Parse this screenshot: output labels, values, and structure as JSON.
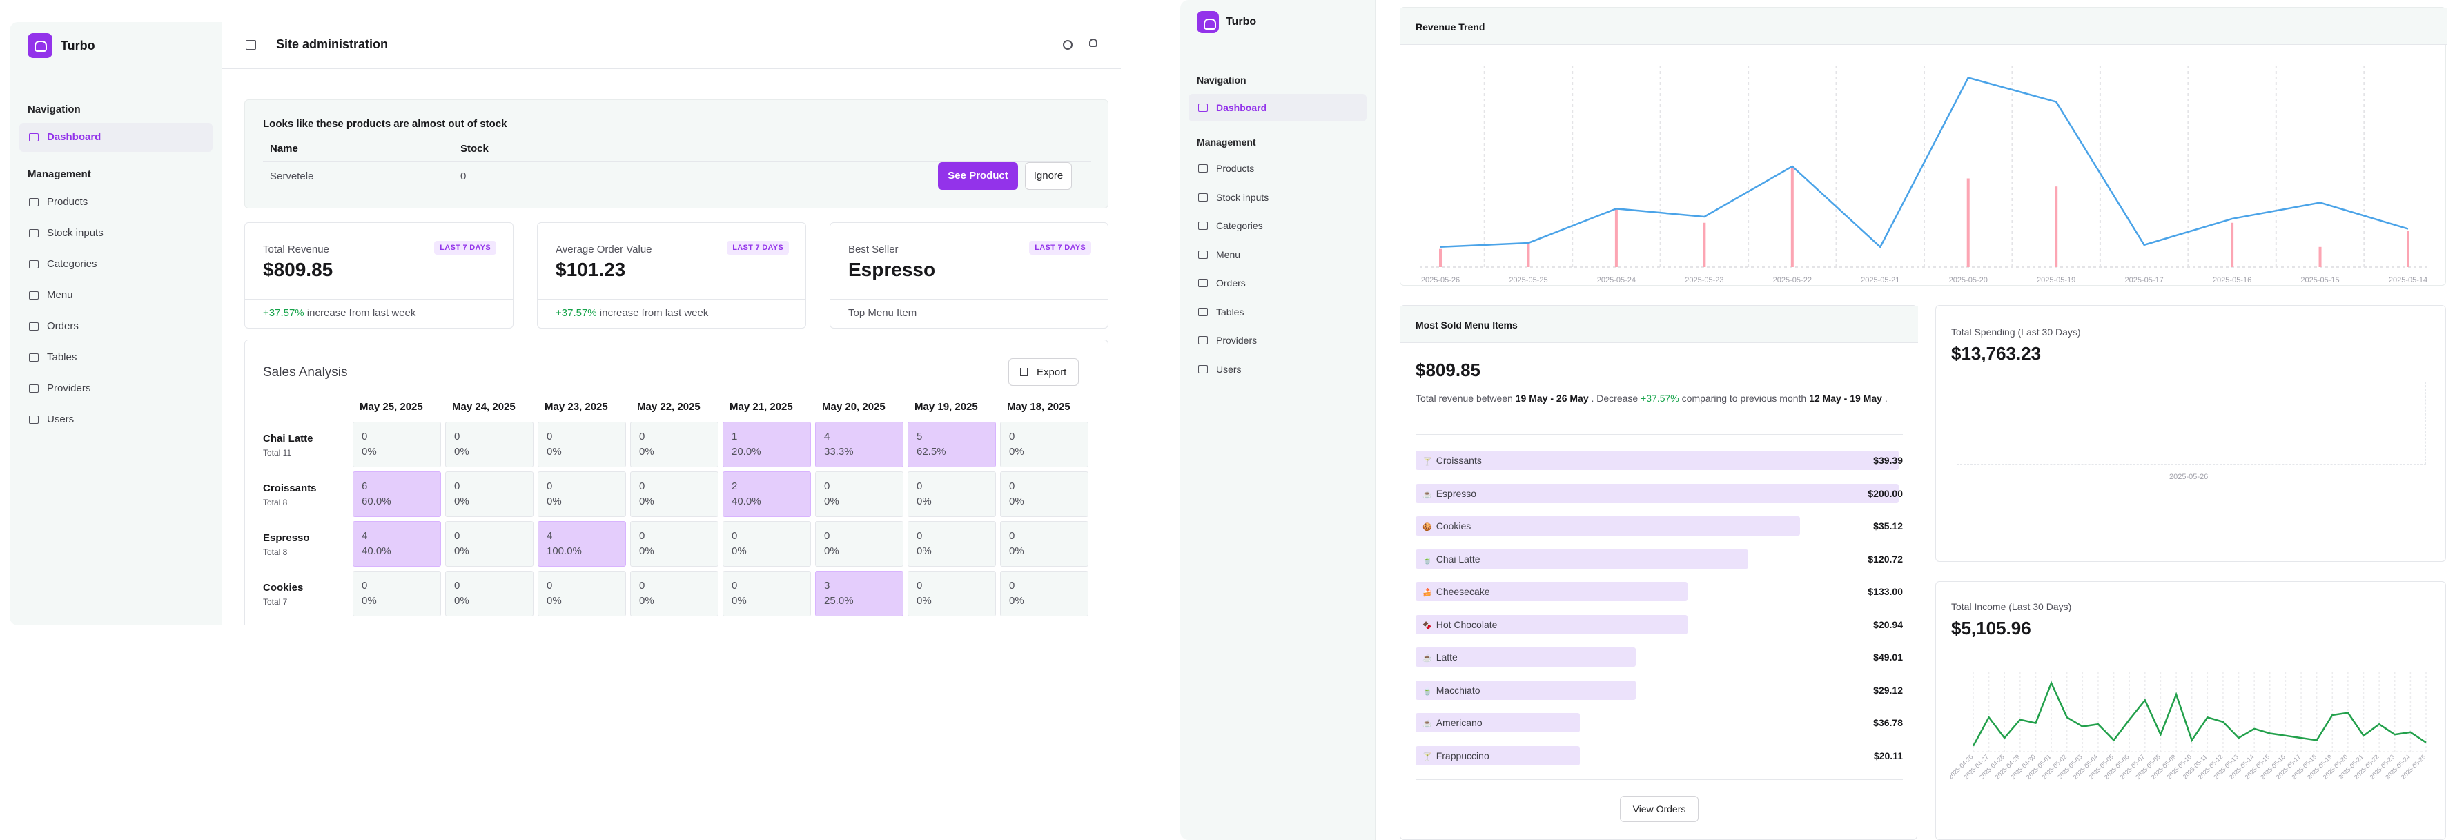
{
  "left": {
    "brand": "Turbo",
    "header_title": "Site administration",
    "nav_heading": "Navigation",
    "nav_active": "Dashboard",
    "mgmt_heading": "Management",
    "mgmt_items": [
      "Products",
      "Stock inputs",
      "Categories",
      "Menu",
      "Orders",
      "Tables",
      "Providers",
      "Users"
    ],
    "stock_alert": {
      "title": "Looks like these products are almost out of stock",
      "col_name": "Name",
      "col_stock": "Stock",
      "row_name": "Servetele",
      "row_stock": "0",
      "primary_btn": "See Product",
      "secondary_btn": "Ignore"
    },
    "stats": [
      {
        "label": "Total Revenue",
        "badge": "LAST 7 DAYS",
        "value": "$809.85",
        "delta": "+37.57%",
        "note": " increase from last week"
      },
      {
        "label": "Average Order Value",
        "badge": "LAST 7 DAYS",
        "value": "$101.23",
        "delta": "+37.57%",
        "note": " increase from last week"
      },
      {
        "label": "Best Seller",
        "badge": "LAST 7 DAYS",
        "value": "Espresso",
        "delta": "",
        "note": "Top Menu Item"
      }
    ],
    "sales": {
      "title": "Sales Analysis",
      "export": "Export",
      "dates": [
        "May 25, 2025",
        "May 24, 2025",
        "May 23, 2025",
        "May 22, 2025",
        "May 21, 2025",
        "May 20, 2025",
        "May 19, 2025",
        "May 18, 2025"
      ],
      "rows": [
        {
          "name": "Chai Latte",
          "total": "Total 11",
          "cells": [
            [
              "0",
              "0%"
            ],
            [
              "0",
              "0%"
            ],
            [
              "0",
              "0%"
            ],
            [
              "0",
              "0%"
            ],
            [
              "1",
              "20.0%"
            ],
            [
              "4",
              "33.3%"
            ],
            [
              "5",
              "62.5%"
            ],
            [
              "0",
              "0%"
            ]
          ]
        },
        {
          "name": "Croissants",
          "total": "Total 8",
          "cells": [
            [
              "6",
              "60.0%"
            ],
            [
              "0",
              "0%"
            ],
            [
              "0",
              "0%"
            ],
            [
              "0",
              "0%"
            ],
            [
              "2",
              "40.0%"
            ],
            [
              "0",
              "0%"
            ],
            [
              "0",
              "0%"
            ],
            [
              "0",
              "0%"
            ]
          ]
        },
        {
          "name": "Espresso",
          "total": "Total 8",
          "cells": [
            [
              "4",
              "40.0%"
            ],
            [
              "0",
              "0%"
            ],
            [
              "4",
              "100.0%"
            ],
            [
              "0",
              "0%"
            ],
            [
              "0",
              "0%"
            ],
            [
              "0",
              "0%"
            ],
            [
              "0",
              "0%"
            ],
            [
              "0",
              "0%"
            ]
          ]
        },
        {
          "name": "Cookies",
          "total": "Total 7",
          "cells": [
            [
              "0",
              "0%"
            ],
            [
              "0",
              "0%"
            ],
            [
              "0",
              "0%"
            ],
            [
              "0",
              "0%"
            ],
            [
              "0",
              "0%"
            ],
            [
              "3",
              "25.0%"
            ],
            [
              "0",
              "0%"
            ],
            [
              "0",
              "0%"
            ]
          ]
        }
      ]
    }
  },
  "right": {
    "brand": "Turbo",
    "nav_heading": "Navigation",
    "nav_active": "Dashboard",
    "mgmt_heading": "Management",
    "mgmt_items": [
      "Products",
      "Stock inputs",
      "Categories",
      "Menu",
      "Orders",
      "Tables",
      "Providers",
      "Users"
    ],
    "revenue_trend_title": "Revenue Trend",
    "most_sold": {
      "title": "Most Sold Menu Items",
      "total": "$809.85",
      "desc_pre": "Total revenue between ",
      "desc_range": "19 May - 26 May",
      "desc_mid": " . Decrease ",
      "desc_delta": "+37.57%",
      "desc_post": " comparing to previous month ",
      "desc_prev": "12 May - 19 May",
      "desc_end": " .",
      "view_btn": "View Orders",
      "items": [
        {
          "name": "Croissants",
          "icon": "🍸",
          "value": "$39.39",
          "fill": 1.0
        },
        {
          "name": "Espresso",
          "icon": "☕",
          "value": "$200.00",
          "fill": 1.0
        },
        {
          "name": "Cookies",
          "icon": "🍪",
          "value": "$35.12",
          "fill": 0.89
        },
        {
          "name": "Chai Latte",
          "icon": "🍵",
          "value": "$120.72",
          "fill": 0.77
        },
        {
          "name": "Cheesecake",
          "icon": "🍰",
          "value": "$133.00",
          "fill": 0.63
        },
        {
          "name": "Hot Chocolate",
          "icon": "🍫",
          "value": "$20.94",
          "fill": 0.63
        },
        {
          "name": "Latte",
          "icon": "☕",
          "value": "$49.01",
          "fill": 0.51
        },
        {
          "name": "Macchiato",
          "icon": "🍵",
          "value": "$29.12",
          "fill": 0.51
        },
        {
          "name": "Americano",
          "icon": "☕",
          "value": "$36.78",
          "fill": 0.38
        },
        {
          "name": "Frappuccino",
          "icon": "🍸",
          "value": "$20.11",
          "fill": 0.38
        }
      ]
    },
    "spending": {
      "title": "Total Spending (Last 30 Days)",
      "value": "$13,763.23",
      "xlabel": "2025-05-26"
    },
    "income": {
      "title": "Total Income (Last 30 Days)",
      "value": "$5,105.96"
    }
  },
  "chart_data": [
    {
      "type": "line",
      "title": "Revenue Trend",
      "categories": [
        "2025-05-26",
        "2025-05-25",
        "2025-05-24",
        "2025-05-23",
        "2025-05-22",
        "2025-05-21",
        "2025-05-20",
        "2025-05-19",
        "2025-05-17",
        "2025-05-16",
        "2025-05-15",
        "2025-05-14"
      ],
      "series": [
        {
          "type": "line",
          "values": [
            10,
            12,
            29,
            25,
            50,
            10,
            94,
            82,
            11,
            24,
            32,
            19
          ]
        },
        {
          "type": "bar",
          "values": [
            9,
            12,
            29,
            22,
            50,
            0,
            44,
            40,
            0,
            22,
            10,
            18
          ]
        }
      ],
      "ylim": [
        0,
        100
      ],
      "grid": true
    },
    {
      "type": "line",
      "title": "Total Income (Last 30 Days)",
      "categories": [
        "2025-04-26",
        "2025-04-27",
        "2025-04-28",
        "2025-04-29",
        "2025-04-30",
        "2025-05-01",
        "2025-05-02",
        "2025-05-03",
        "2025-05-04",
        "2025-05-05",
        "2025-05-06",
        "2025-05-07",
        "2025-05-08",
        "2025-05-09",
        "2025-05-10",
        "2025-05-11",
        "2025-05-12",
        "2025-05-13",
        "2025-05-14",
        "2025-05-15",
        "2025-05-16",
        "2025-05-17",
        "2025-05-18",
        "2025-05-19",
        "2025-05-20",
        "2025-05-21",
        "2025-05-22",
        "2025-05-23",
        "2025-05-24",
        "2025-05-25"
      ],
      "series": [
        {
          "values": [
            5,
            30,
            12,
            28,
            25,
            60,
            30,
            22,
            24,
            10,
            28,
            45,
            15,
            50,
            10,
            30,
            26,
            12,
            20,
            16,
            14,
            12,
            10,
            32,
            34,
            14,
            24,
            15,
            17,
            8
          ]
        }
      ],
      "ylim": [
        0,
        70
      ],
      "grid": true
    }
  ]
}
